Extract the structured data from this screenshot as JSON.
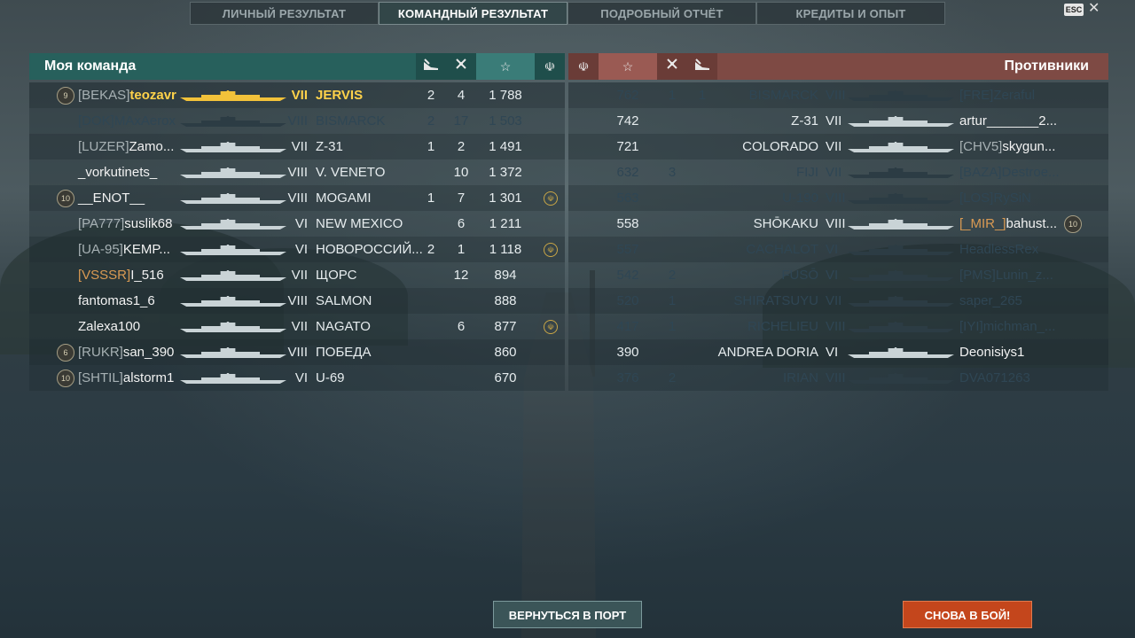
{
  "tabs": [
    {
      "label": "ЛИЧНЫЙ РЕЗУЛЬТАТ"
    },
    {
      "label": "КОМАНДНЫЙ РЕЗУЛЬТАТ"
    },
    {
      "label": "ПОДРОБНЫЙ ОТЧЁТ"
    },
    {
      "label": "КРЕДИТЫ И ОПЫТ"
    }
  ],
  "active_tab": "КОМАНДНЫЙ РЕЗУЛЬТАТ",
  "esc_label": "ESC",
  "my_team": {
    "title": "Моя команда",
    "header_icons": [
      "ship-kills-icon",
      "plane-kills-icon",
      "star-icon",
      "achievement-icon"
    ],
    "rows": [
      {
        "badge": "9",
        "clan": "[BEKAS]",
        "name": "teozavr",
        "tier": "VII",
        "ship": "JERVIS",
        "kills": "2",
        "planes": "4",
        "score": "1 788",
        "medal": false,
        "highlight": true,
        "dim": false,
        "clan_gold": false
      },
      {
        "badge": "",
        "clan": "[DOK]",
        "name": "MAxAerox",
        "tier": "VIII",
        "ship": "BISMARCK",
        "kills": "2",
        "planes": "17",
        "score": "1 503",
        "medal": false,
        "highlight": false,
        "dim": true,
        "clan_gold": true
      },
      {
        "badge": "",
        "clan": "[LUZER]",
        "name": "Zamo...",
        "tier": "VII",
        "ship": "Z-31",
        "kills": "1",
        "planes": "2",
        "score": "1 491",
        "medal": false,
        "highlight": false,
        "dim": false,
        "clan_gold": false
      },
      {
        "badge": "",
        "clan": "",
        "name": "_vorkutinets_",
        "tier": "VIII",
        "ship": "V. VENETO",
        "kills": "",
        "planes": "10",
        "score": "1 372",
        "medal": false,
        "highlight": false,
        "dim": false,
        "clan_gold": false
      },
      {
        "badge": "10",
        "clan": "",
        "name": "__ENOT__",
        "tier": "VIII",
        "ship": "MOGAMI",
        "kills": "1",
        "planes": "7",
        "score": "1 301",
        "medal": true,
        "highlight": false,
        "dim": false,
        "clan_gold": false
      },
      {
        "badge": "",
        "clan": "[PA777]",
        "name": "suslik68",
        "tier": "VI",
        "ship": "NEW MEXICO",
        "kills": "",
        "planes": "6",
        "score": "1 211",
        "medal": false,
        "highlight": false,
        "dim": false,
        "clan_gold": false
      },
      {
        "badge": "",
        "clan": "[UA-95]",
        "name": "KEMP...",
        "tier": "VI",
        "ship": "НОВОРОССИЙ...",
        "kills": "2",
        "planes": "1",
        "score": "1 118",
        "medal": true,
        "highlight": false,
        "dim": false,
        "clan_gold": false
      },
      {
        "badge": "",
        "clan": "[VSSSR]",
        "name": "I_516",
        "tier": "VII",
        "ship": "ЩОРС",
        "kills": "",
        "planes": "12",
        "score": "894",
        "medal": false,
        "highlight": false,
        "dim": false,
        "clan_gold": true
      },
      {
        "badge": "",
        "clan": "",
        "name": "fantomas1_6",
        "tier": "VIII",
        "ship": "SALMON",
        "kills": "",
        "planes": "",
        "score": "888",
        "medal": false,
        "highlight": false,
        "dim": false,
        "clan_gold": false
      },
      {
        "badge": "",
        "clan": "",
        "name": "Zalexa100",
        "tier": "VII",
        "ship": "NAGATO",
        "kills": "",
        "planes": "6",
        "score": "877",
        "medal": true,
        "highlight": false,
        "dim": false,
        "clan_gold": false
      },
      {
        "badge": "6",
        "clan": "[RUKR]",
        "name": "san_390",
        "tier": "VIII",
        "ship": "ПОБЕДА",
        "kills": "",
        "planes": "",
        "score": "860",
        "medal": false,
        "highlight": false,
        "dim": false,
        "clan_gold": false
      },
      {
        "badge": "10",
        "clan": "[SHTIL]",
        "name": "alstorm1",
        "tier": "VI",
        "ship": "U-69",
        "kills": "",
        "planes": "",
        "score": "670",
        "medal": false,
        "highlight": false,
        "dim": false,
        "clan_gold": false
      }
    ]
  },
  "enemy_team": {
    "title": "Противники",
    "header_icons": [
      "achievement-icon",
      "star-icon",
      "plane-kills-icon",
      "ship-kills-icon"
    ],
    "rows": [
      {
        "score": "762",
        "planes": "1",
        "kills": "1",
        "ship": "BISMARCK",
        "tier": "VIII",
        "clan": "[FRE]",
        "name": "Zeraful",
        "badge": "",
        "dim": true,
        "clan_gold": false
      },
      {
        "score": "742",
        "planes": "",
        "kills": "",
        "ship": "Z-31",
        "tier": "VII",
        "clan": "",
        "name": "artur_______2...",
        "badge": "",
        "dim": false,
        "clan_gold": false
      },
      {
        "score": "721",
        "planes": "",
        "kills": "",
        "ship": "COLORADO",
        "tier": "VII",
        "clan": "[CHV5]",
        "name": "skygun...",
        "badge": "",
        "dim": false,
        "clan_gold": false
      },
      {
        "score": "632",
        "planes": "3",
        "kills": "",
        "ship": "FIJI",
        "tier": "VII",
        "clan": "[BAZA]",
        "name": "Destroe...",
        "badge": "",
        "dim": true,
        "clan_gold": false
      },
      {
        "score": "563",
        "planes": "",
        "kills": "",
        "ship": "U-190",
        "tier": "VIII",
        "clan": "[LOS]",
        "name": "RySiN",
        "badge": "",
        "dim": true,
        "clan_gold": false
      },
      {
        "score": "558",
        "planes": "",
        "kills": "",
        "ship": "SHŌKAKU",
        "tier": "VIII",
        "clan": "[_MIR_]",
        "name": "bahust...",
        "badge": "10",
        "dim": false,
        "clan_gold": true
      },
      {
        "score": "557",
        "planes": "",
        "kills": "",
        "ship": "CACHALOT",
        "tier": "VI",
        "clan": "",
        "name": "HeadlessRex",
        "badge": "",
        "dim": true,
        "clan_gold": false
      },
      {
        "score": "542",
        "planes": "2",
        "kills": "",
        "ship": "FUSŌ",
        "tier": "VI",
        "clan": "[PMS]",
        "name": "Lunin_z...",
        "badge": "",
        "dim": true,
        "clan_gold": false
      },
      {
        "score": "520",
        "planes": "1",
        "kills": "",
        "ship": "SHIRATSUYU",
        "tier": "VII",
        "clan": "",
        "name": "saper_265",
        "badge": "",
        "dim": true,
        "clan_gold": false
      },
      {
        "score": "417",
        "planes": "1",
        "kills": "",
        "ship": "RICHELIEU",
        "tier": "VIII",
        "clan": "[IYI]",
        "name": "michman_...",
        "badge": "",
        "dim": true,
        "clan_gold": false
      },
      {
        "score": "390",
        "planes": "",
        "kills": "",
        "ship": "ANDREA DORIA",
        "tier": "VI",
        "clan": "",
        "name": "Deonisiys1",
        "badge": "",
        "dim": false,
        "clan_gold": false
      },
      {
        "score": "376",
        "planes": "2",
        "kills": "",
        "ship": "IRIAN",
        "tier": "VIII",
        "clan": "",
        "name": "DVA071263",
        "badge": "",
        "dim": true,
        "clan_gold": false
      }
    ]
  },
  "buttons": {
    "port": "ВЕРНУТЬСЯ В ПОРТ",
    "battle": "СНОВА В БОЙ!"
  },
  "colors": {
    "my_team_header": "#27605c",
    "enemy_header": "#7e4a44",
    "highlight": "#ffd24a",
    "clan_gold": "#d99a53",
    "battle_button": "#c4461c"
  }
}
